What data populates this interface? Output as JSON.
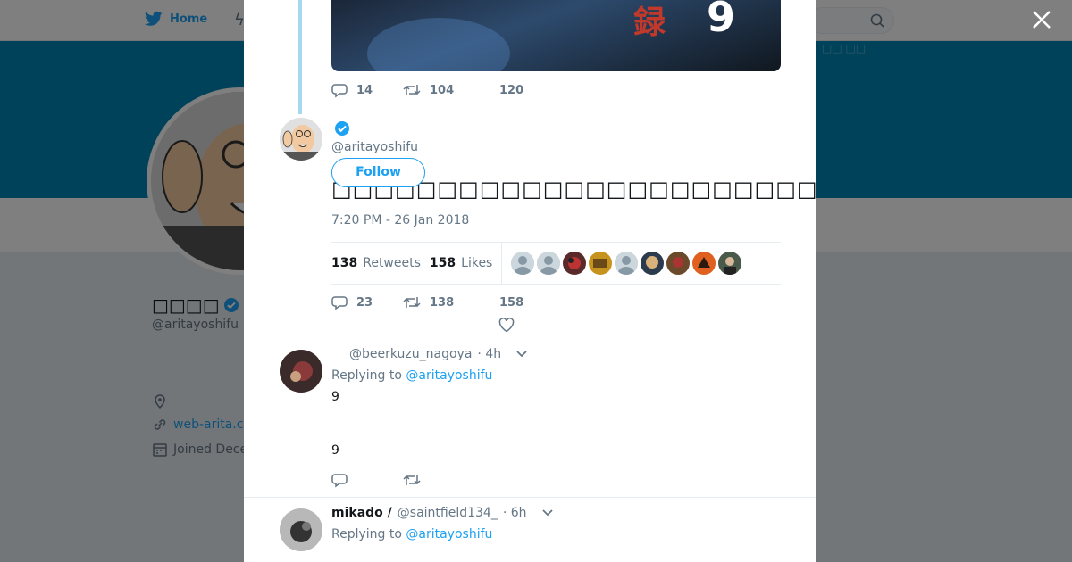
{
  "nav": {
    "home_label": "Home"
  },
  "profile": {
    "name": "□□□□",
    "handle": "@aritayoshifu",
    "link": "web-arita.co",
    "joined": "Joined Dece"
  },
  "banner_ghost_text": "□□ □□",
  "main_tweet": {
    "prev_actions": {
      "replies": "14",
      "retweets": "104",
      "likes": "120"
    },
    "handle": "@aritayoshifu",
    "follow_label": "Follow",
    "text": "□□□□□□□□□□□□□□□□□□□□□□□□□□□□□□□□□□□□□□□□□□□□□□□□□□□□□",
    "time": "7:20 PM - 26 Jan 2018",
    "retweet_count": "138",
    "retweets_label": "Retweets",
    "like_count": "158",
    "likes_label": "Likes",
    "actions": {
      "replies": "23",
      "retweets": "138",
      "likes": "158"
    }
  },
  "replies": [
    {
      "name": "",
      "handle": "@beerkuzu_nagoya",
      "time": "· 4h",
      "replying_prefix": "Replying to",
      "replying_to": "@aritayoshifu",
      "line1": "9",
      "line2": "9"
    },
    {
      "name": "mikado /",
      "handle": "@saintfield134_",
      "time": "· 6h",
      "replying_prefix": "Replying to",
      "replying_to": "@aritayoshifu"
    }
  ],
  "media_text": {
    "red": "録",
    "white": "9"
  },
  "colors": {
    "accent": "#1da1f2",
    "banner": "#0084b4",
    "overlay": "rgba(0,0,0,0.5)"
  }
}
